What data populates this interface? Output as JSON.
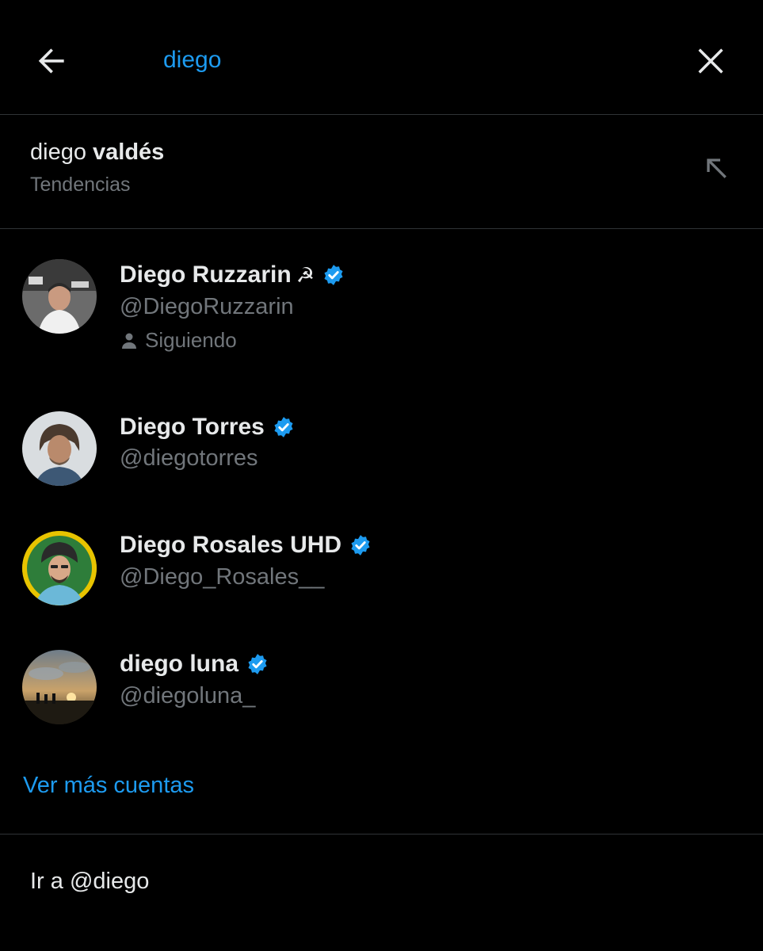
{
  "header": {
    "search_value": "diego",
    "back_icon": "arrow-left-icon",
    "close_icon": "close-icon"
  },
  "trend": {
    "query_plain": "diego ",
    "query_bold": "valdés",
    "subtitle": "Tendencias",
    "icon": "arrow-up-left-icon"
  },
  "accounts": [
    {
      "name": "Diego Ruzzarin",
      "emoji": "☭",
      "handle": "@DiegoRuzzarin",
      "verified": true,
      "following_label": "Siguiendo"
    },
    {
      "name": "Diego Torres",
      "handle": "@diegotorres",
      "verified": true
    },
    {
      "name": "Diego Rosales UHD",
      "handle": "@Diego_Rosales__",
      "verified": true
    },
    {
      "name": "diego luna",
      "handle": "@diegoluna_",
      "verified": true
    }
  ],
  "more_accounts_label": "Ver más cuentas",
  "goto_label": "Ir a @diego",
  "colors": {
    "background": "#000000",
    "accent": "#1d9bf0",
    "text_primary": "#e7e9ea",
    "text_secondary": "#71767b",
    "border": "#2f3336"
  }
}
